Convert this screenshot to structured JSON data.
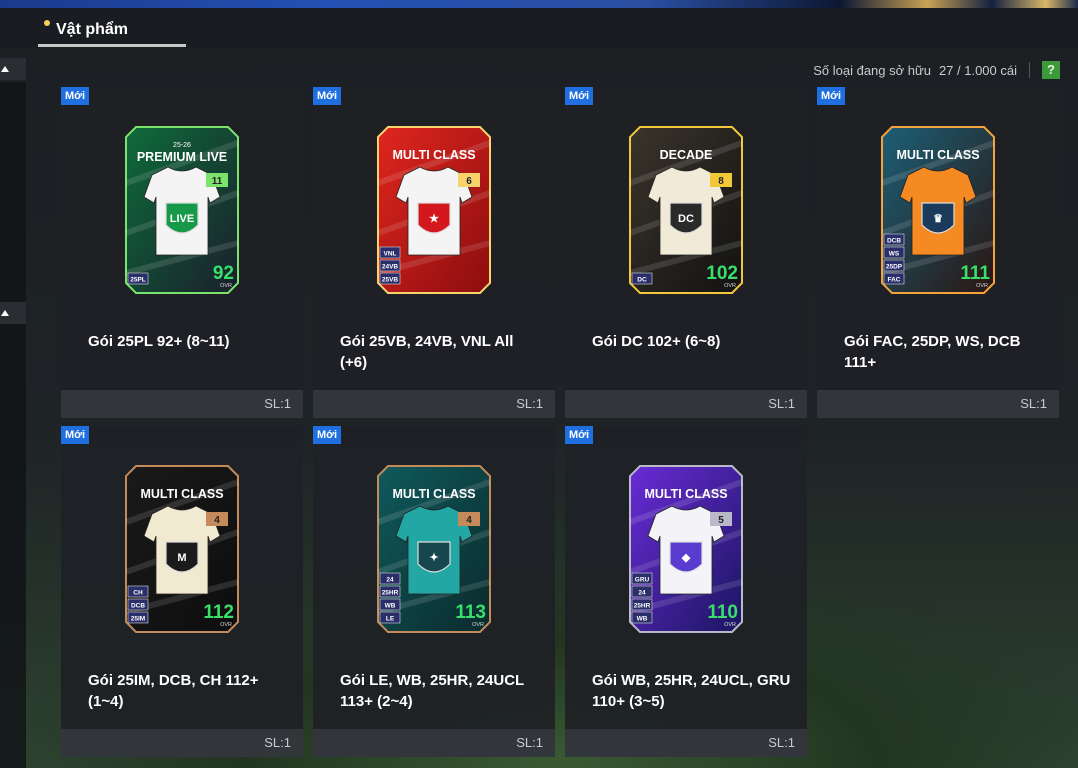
{
  "header": {
    "tab_label": "Vật phẩm"
  },
  "inventory": {
    "label": "Số loại đang sở hữu",
    "count": "27 / 1.000 cái",
    "help": "?"
  },
  "packs": [
    {
      "badge": "Mới",
      "title": "Gói 25PL 92+ (8~11)",
      "qty": "SL:1",
      "card": {
        "header": "PREMIUM LIVE",
        "season": "25-26",
        "grade": "11",
        "ovr": "92",
        "ovr_label": "OVR",
        "crest": "LIVE",
        "tags": [
          "25PL"
        ],
        "bg1": "#0e6b3a",
        "bg2": "#1a1f2c",
        "accent": "#7be36c",
        "shirt": "#f4f4f4",
        "crest_color": "#169a4a"
      }
    },
    {
      "badge": "Mới",
      "title": "Gói 25VB, 24VB, VNL All (+6)",
      "qty": "SL:1",
      "card": {
        "header": "MULTI CLASS",
        "grade": "6",
        "crest": "★",
        "tags": [
          "VNL",
          "24VB",
          "25VB"
        ],
        "bg1": "#e0261e",
        "bg2": "#8c0d0f",
        "accent": "#f6d36b",
        "shirt": "#f4f4f4",
        "crest_color": "#d3171d"
      }
    },
    {
      "badge": "Mới",
      "title": "Gói DC 102+ (6~8)",
      "qty": "SL:1",
      "card": {
        "header": "DECADE",
        "grade": "8",
        "ovr": "102",
        "ovr_label": "OVR",
        "crest": "DC",
        "tags": [
          "DC"
        ],
        "bg1": "#3a342b",
        "bg2": "#121212",
        "accent": "#f2c83b",
        "shirt": "#f1ead7",
        "crest_color": "#2a2a2a"
      }
    },
    {
      "badge": "Mới",
      "title": "Gói FAC, 25DP, WS, DCB 111+",
      "qty": "SL:1",
      "card": {
        "header": "MULTI CLASS",
        "grade": "",
        "ovr": "111",
        "ovr_label": "OVR",
        "crest": "♛",
        "tags": [
          "DCB",
          "WS",
          "25DP",
          "FAC"
        ],
        "bg1": "#1c5f76",
        "bg2": "#2a1512",
        "accent": "#f2a33b",
        "shirt": "#f58a22",
        "crest_color": "#1c3a5a"
      }
    },
    {
      "badge": "Mới",
      "title": "Gói 25IM, DCB, CH 112+ (1~4)",
      "qty": "SL:1",
      "card": {
        "header": "MULTI CLASS",
        "grade": "4",
        "ovr": "112",
        "ovr_label": "OVR",
        "crest": "M",
        "tags": [
          "CH",
          "DCB",
          "25IM"
        ],
        "bg1": "#1a1a1a",
        "bg2": "#0d0d0d",
        "accent": "#c58a5a",
        "shirt": "#f1ead1",
        "crest_color": "#1b1b1b"
      }
    },
    {
      "badge": "Mới",
      "title": "Gói LE, WB, 25HR, 24UCL 113+ (2~4)",
      "qty": "SL:1",
      "card": {
        "header": "MULTI CLASS",
        "grade": "4",
        "ovr": "113",
        "ovr_label": "OVR",
        "crest": "✦",
        "tags": [
          "24",
          "25HR",
          "WB",
          "LE"
        ],
        "bg1": "#0f5a5c",
        "bg2": "#0b2a2c",
        "accent": "#c58a5a",
        "shirt": "#22a7a5",
        "crest_color": "#17474e"
      }
    },
    {
      "badge": "Mới",
      "title": "Gói WB, 25HR, 24UCL, GRU 110+ (3~5)",
      "qty": "SL:1",
      "card": {
        "header": "MULTI CLASS",
        "grade": "5",
        "ovr": "110",
        "ovr_label": "OVR",
        "crest": "◆",
        "tags": [
          "GRU",
          "24",
          "25HR",
          "WB"
        ],
        "bg1": "#6a2bd6",
        "bg2": "#1a1660",
        "accent": "#b9b9c9",
        "shirt": "#f4f4f8",
        "crest_color": "#5a3bd0"
      }
    }
  ]
}
